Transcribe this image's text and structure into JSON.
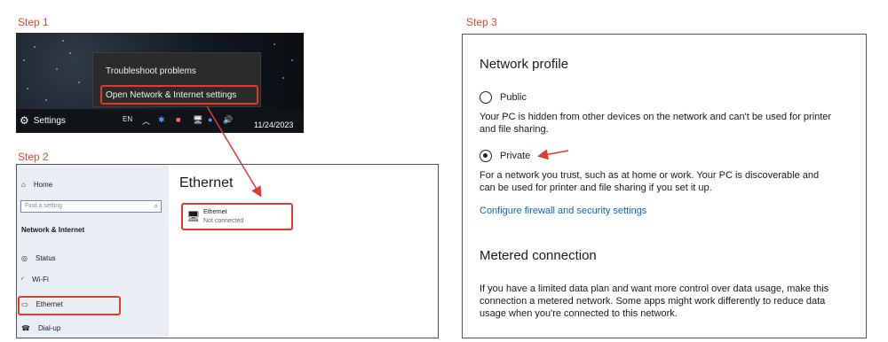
{
  "steps": {
    "step1_label": "Step 1",
    "step2_label": "Step 2",
    "step3_label": "Step 3"
  },
  "step1": {
    "menu": {
      "troubleshoot": "Troubleshoot problems",
      "open_settings": "Open Network & Internet settings"
    },
    "taskbar": {
      "settings_label": "Settings",
      "lang": "EN",
      "date": "11/24/2023"
    }
  },
  "step2": {
    "home": "Home",
    "search_placeholder": "Find a setting",
    "section": "Network & Internet",
    "nav": {
      "status": "Status",
      "wifi": "Wi-Fi",
      "ethernet": "Ethernet",
      "dialup": "Dial-up"
    },
    "page_title": "Ethernet",
    "card": {
      "name": "Ethernet",
      "status": "Not connected"
    }
  },
  "step3": {
    "network_profile_title": "Network profile",
    "public_label": "Public",
    "public_desc": "Your PC is hidden from other devices on the network and can't be used for printer and file sharing.",
    "private_label": "Private",
    "private_desc": "For a network you trust, such as at home or work. Your PC is discoverable and can be used for printer and file sharing if you set it up.",
    "firewall_link": "Configure firewall and security settings",
    "metered_title": "Metered connection",
    "metered_desc": "If you have a limited data plan and want more control over data usage, make this connection a metered network. Some apps might work differently to reduce data usage when you're connected to this network.",
    "selected_profile": "Private"
  },
  "colors": {
    "highlight": "#e03a2f",
    "link": "#0a66c2",
    "step_label": "#e0462a"
  }
}
